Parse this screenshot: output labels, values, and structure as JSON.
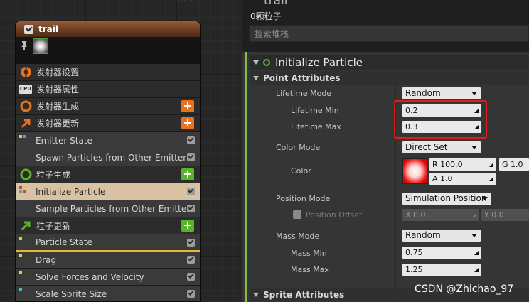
{
  "graph": {
    "emitter": {
      "name": "trail",
      "rows": [
        {
          "label": "发射器设置",
          "kind": "section",
          "icon": "emitter-settings-icon"
        },
        {
          "label": "发射器属性",
          "kind": "section",
          "icon": "cpu-icon",
          "icon_text": "CPU"
        },
        {
          "label": "发射器生成",
          "kind": "section",
          "icon": "emitter-spawn-icon",
          "add": "orange"
        },
        {
          "label": "发射器更新",
          "kind": "section",
          "icon": "emitter-update-icon",
          "add": "orange"
        },
        {
          "label": "Emitter State",
          "kind": "module",
          "checked": true
        },
        {
          "label": "Spawn Particles from Other Emitter",
          "kind": "module",
          "checked": true
        },
        {
          "label": "粒子生成",
          "kind": "section",
          "icon": "particle-spawn-icon",
          "add": "green"
        },
        {
          "label": "Initialize Particle",
          "kind": "module",
          "checked": true,
          "selected": true
        },
        {
          "label": "Sample Particles from Other Emitter",
          "kind": "module",
          "checked": true
        },
        {
          "label": "粒子更新",
          "kind": "section",
          "icon": "particle-update-icon",
          "add": "green"
        },
        {
          "label": "Particle State",
          "kind": "module",
          "checked": true
        },
        {
          "label": "Drag",
          "kind": "module",
          "checked": true
        },
        {
          "label": "Solve Forces and Velocity",
          "kind": "module",
          "checked": true
        },
        {
          "label": "Scale Sprite Size",
          "kind": "module",
          "checked": true
        }
      ]
    }
  },
  "panel": {
    "title": "trail",
    "particle_count": "0颗粒子",
    "search_placeholder": "搜索堆栈",
    "category": "Initialize Particle",
    "point_attributes": {
      "header": "Point Attributes",
      "lifetime_mode": {
        "label": "Lifetime Mode",
        "value": "Random"
      },
      "lifetime_min": {
        "label": "Lifetime Min",
        "value": "0.2"
      },
      "lifetime_max": {
        "label": "Lifetime Max",
        "value": "0.3"
      },
      "color_mode": {
        "label": "Color Mode",
        "value": "Direct Set"
      },
      "color": {
        "label": "Color",
        "r": "R 100.0",
        "g": "G 1.0",
        "a": "A 1.0"
      },
      "position_mode": {
        "label": "Position Mode",
        "value": "Simulation Position"
      },
      "position_offset": {
        "label": "Position Offset",
        "x": "X 0.0",
        "y": "Y 0.0"
      },
      "mass_mode": {
        "label": "Mass Mode",
        "value": "Random"
      },
      "mass_min": {
        "label": "Mass Min",
        "value": "0.75"
      },
      "mass_max": {
        "label": "Mass Max",
        "value": "1.25"
      }
    },
    "sprite_attributes": {
      "header": "Sprite Attributes"
    }
  },
  "watermark": "CSDN @Zhichao_97",
  "colors": {
    "accent_green": "#58b52b",
    "accent_orange": "#e8731c",
    "highlight_red": "#e11b1b",
    "selected_row": "#d9c2a2"
  }
}
